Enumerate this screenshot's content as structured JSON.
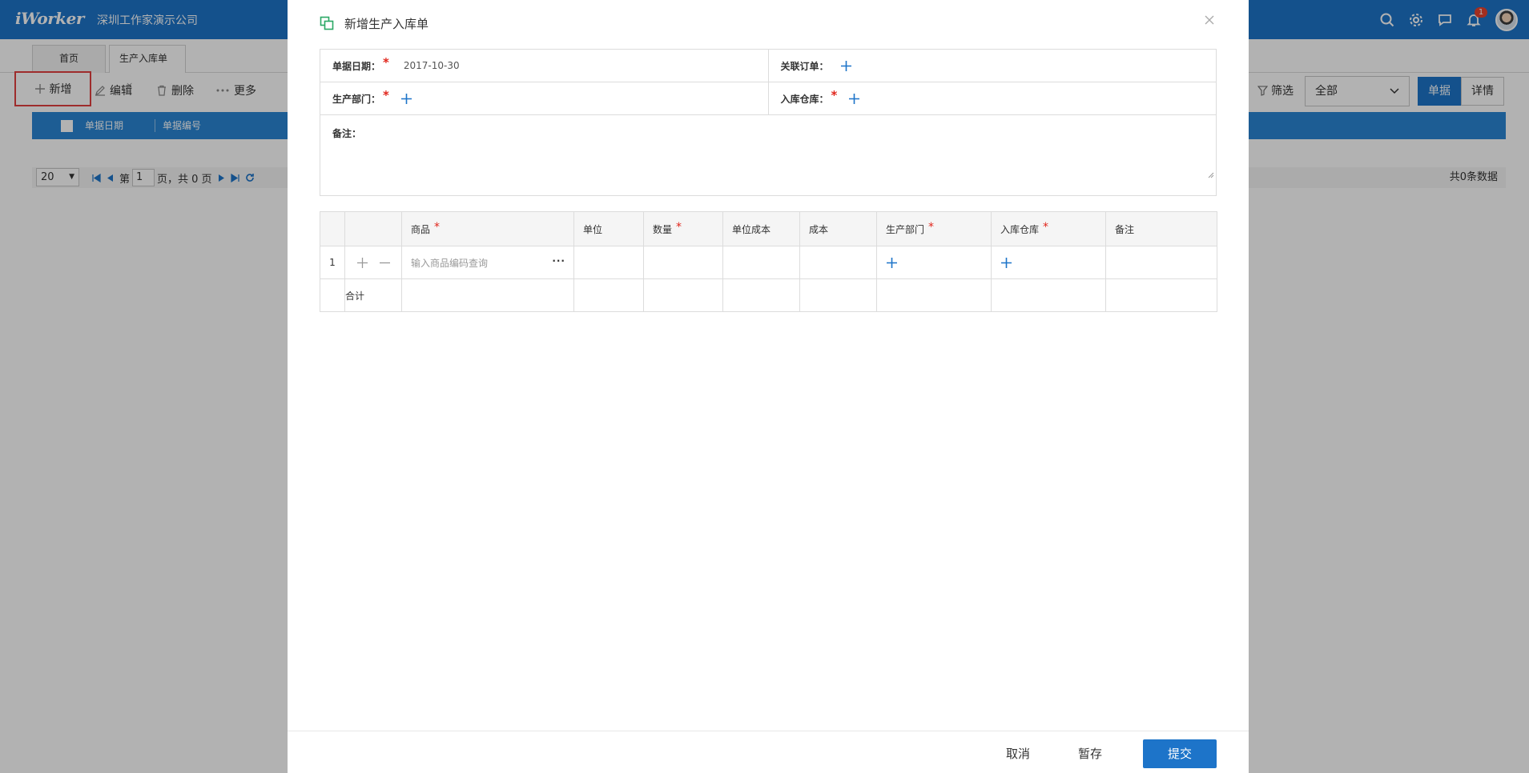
{
  "app": {
    "logo": "iWorker",
    "company": "深圳工作家演示公司",
    "notification_count": "1",
    "brand_color": "#1d74c9"
  },
  "tabs": [
    {
      "label": "首页"
    },
    {
      "label": "生产入库单",
      "close": "×"
    }
  ],
  "toolbar": {
    "new_label": "新增",
    "edit_label": "编辑",
    "delete_label": "删除",
    "more_label": "更多",
    "filter_label": "筛选",
    "filter_value": "全部",
    "view_single": "单据",
    "view_detail": "详情"
  },
  "list": {
    "col_date": "单据日期",
    "col_number": "单据编号"
  },
  "pager": {
    "page_size": "20",
    "page_prefix": "第",
    "page_value": "1",
    "page_suffix": "页，共 0 页",
    "total": "共0条数据"
  },
  "modal": {
    "title": "新增生产入库单",
    "date_label": "单据日期：",
    "date_value": "2017-10-30",
    "order_label": "关联订单：",
    "dept_label": "生产部门：",
    "warehouse_label": "入库仓库：",
    "remark_label": "备注：",
    "required_mark": "*",
    "grid": {
      "headers": {
        "product": "商品",
        "unit": "单位",
        "qty": "数量",
        "unit_cost": "单位成本",
        "cost": "成本",
        "dept": "生产部门",
        "warehouse": "入库仓库",
        "remark": "备注"
      },
      "row_number": "1",
      "product_placeholder": "输入商品编码查询",
      "product_more": "···",
      "total_label": "合计"
    },
    "footer": {
      "cancel": "取消",
      "draft": "暂存",
      "submit": "提交"
    }
  }
}
